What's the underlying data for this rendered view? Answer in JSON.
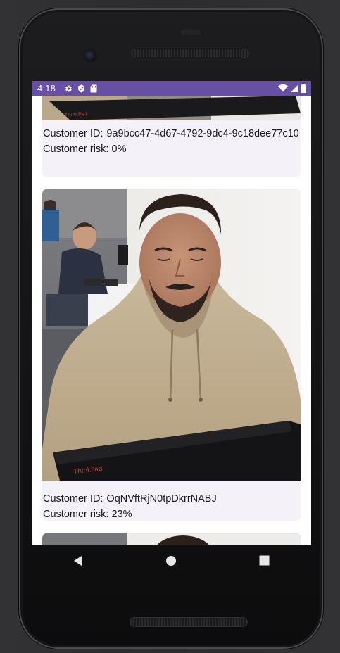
{
  "status_bar": {
    "time": "4:18",
    "left_icons": [
      "gear-icon",
      "shield-icon",
      "sd-card-icon"
    ],
    "right_icons": [
      "wifi-icon",
      "cellular-signal-icon",
      "battery-icon"
    ],
    "background_color": "#6750a4"
  },
  "feed": {
    "cards": [
      {
        "customer_id_label": "Customer ID:",
        "customer_id": "9a9bcc47-4d67-4792-9dc4-9c18dee77c10",
        "risk_label": "Customer risk:",
        "risk": "0%",
        "laptop_brand": "ThinkPad"
      },
      {
        "customer_id_label": "Customer ID:",
        "customer_id": "OqNVftRjN0tpDkrrNABJ",
        "risk_label": "Customer risk:",
        "risk": "23%",
        "laptop_brand": "ThinkPad"
      },
      {
        "customer_id_label": "",
        "customer_id": "",
        "risk_label": "",
        "risk": ""
      }
    ]
  },
  "nav_bar": {
    "back": "back-icon",
    "home": "home-icon",
    "recents": "recents-icon"
  },
  "colors": {
    "accent": "#6750a4",
    "card_background": "#f4f2f8",
    "text": "#1c1b1f"
  }
}
